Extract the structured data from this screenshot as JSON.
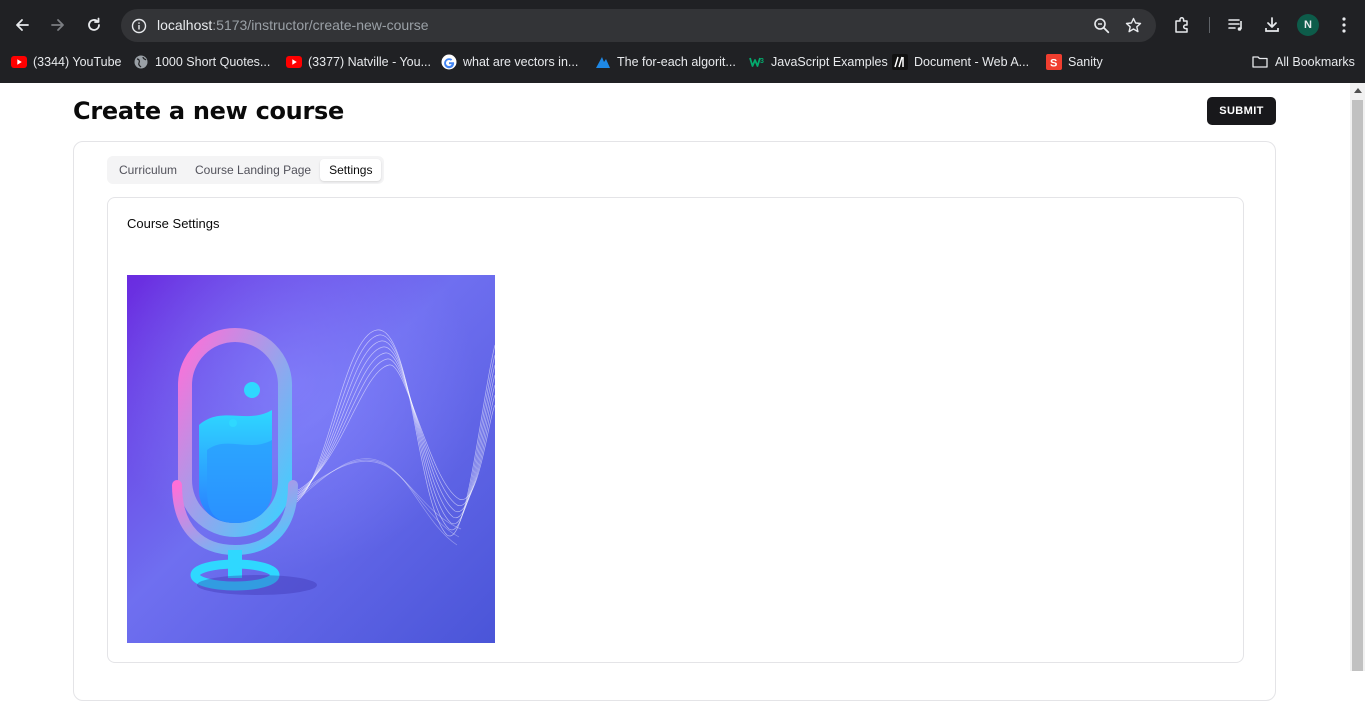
{
  "browser": {
    "url_host": "localhost",
    "url_path": ":5173/instructor/create-new-course",
    "profile_initial": "N",
    "bookmarks": [
      {
        "label": "(3344) YouTube",
        "icon": "youtube-icon"
      },
      {
        "label": "1000 Short Quotes...",
        "icon": "globe-icon"
      },
      {
        "label": "(3377) Natville - You...",
        "icon": "youtube-icon"
      },
      {
        "label": "what are vectors in...",
        "icon": "google-icon"
      },
      {
        "label": "The for-each algorit...",
        "icon": "shark-icon"
      },
      {
        "label": "JavaScript Examples",
        "icon": "w3-icon"
      },
      {
        "label": "Document - Web A...",
        "icon": "mdn-icon"
      },
      {
        "label": "Sanity",
        "icon": "sanity-icon"
      }
    ],
    "all_bookmarks_label": "All Bookmarks"
  },
  "page": {
    "title": "Create a new course",
    "submit_label": "SUBMIT",
    "tabs": [
      {
        "label": "Curriculum",
        "active": false
      },
      {
        "label": "Course Landing Page",
        "active": false
      },
      {
        "label": "Settings",
        "active": true
      }
    ],
    "settings": {
      "title": "Course Settings",
      "image_icon": "microphone-soundwave-illustration"
    }
  },
  "colors": {
    "chrome_bg": "#202124",
    "omnibox_bg": "#333437",
    "submit_bg": "#18181b",
    "tabs_bg": "#f4f4f5",
    "youtube_red": "#ff0000",
    "sanity_red": "#f03e2f",
    "image_gradient_start": "#6a2be0",
    "image_gradient_end": "#4a55d8"
  }
}
